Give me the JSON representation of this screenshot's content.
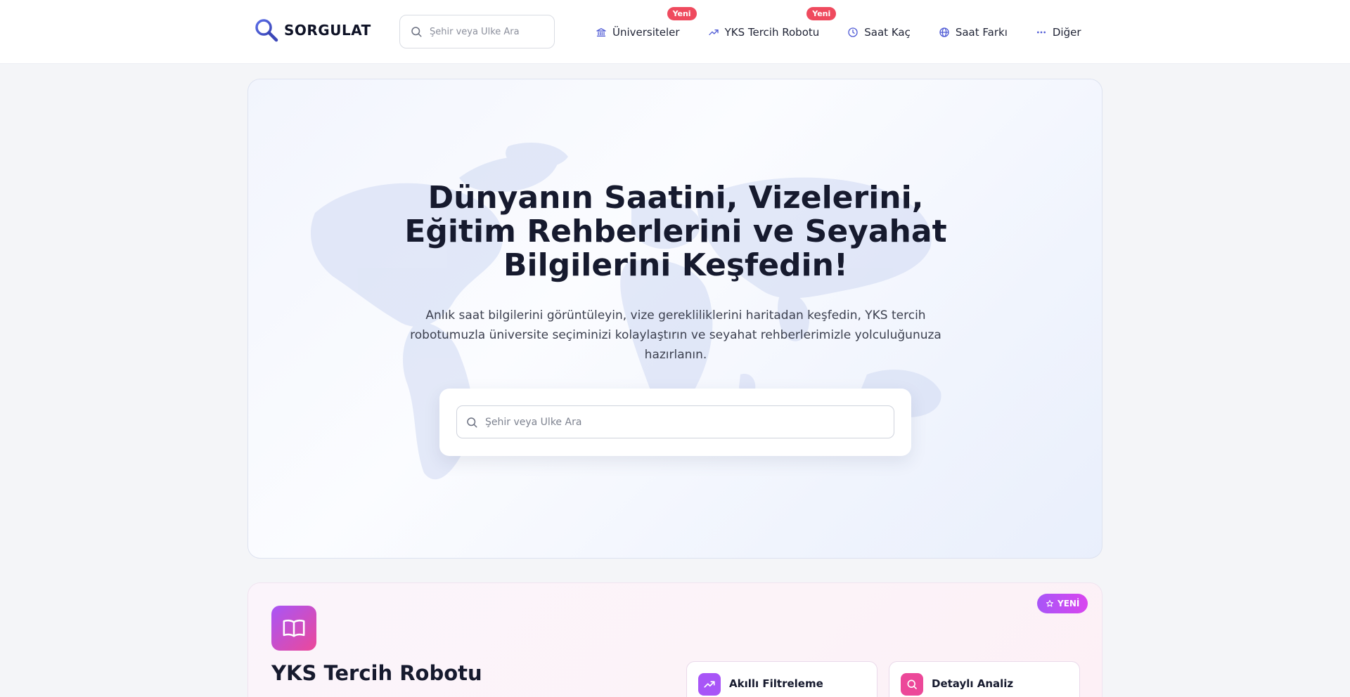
{
  "header": {
    "logo_text": "SORGULAT",
    "search_placeholder": "Şehir veya Ülke Ara",
    "nav": [
      {
        "label": "Üniversiteler",
        "icon": "university-icon",
        "badge": "Yeni"
      },
      {
        "label": "YKS Tercih Robotu",
        "icon": "trending-up-icon",
        "badge": "Yeni"
      },
      {
        "label": "Saat Kaç",
        "icon": "clock-icon"
      },
      {
        "label": "Saat Farkı",
        "icon": "globe-icon"
      },
      {
        "label": "Diğer",
        "icon": "more-dots-icon"
      }
    ]
  },
  "hero": {
    "title_line1": "Dünyanın Saatini, Vizelerini,",
    "title_line2": "Eğitim Rehberlerini ve Seyahat",
    "title_line3": "Bilgilerini Keşfedin!",
    "subtitle_line1": "Anlık saat bilgilerini görüntüleyin, vize gerekliliklerini haritadan keşfedin, YKS tercih",
    "subtitle_line2": "robotumuzla üniversite seçiminizi kolaylaştırın ve seyahat rehberlerimizle yolculuğunuza",
    "subtitle_line3": "hazırlanın.",
    "search_placeholder": "Şehir veya Ülke Ara"
  },
  "yks_card": {
    "icon": "book-open-icon",
    "badge": "YENİ",
    "title": "YKS Tercih Robotu",
    "features": [
      {
        "label": "Akıllı Filtreleme",
        "icon": "trending-up-icon",
        "color": "#a855f7"
      },
      {
        "label": "Detaylı Analiz",
        "icon": "search-icon",
        "color": "#ec4899"
      }
    ]
  },
  "colors": {
    "accent_indigo": "#4f5bd5",
    "badge_red": "#ef4a5e",
    "purple": "#a855f7",
    "pink": "#ec4899"
  }
}
